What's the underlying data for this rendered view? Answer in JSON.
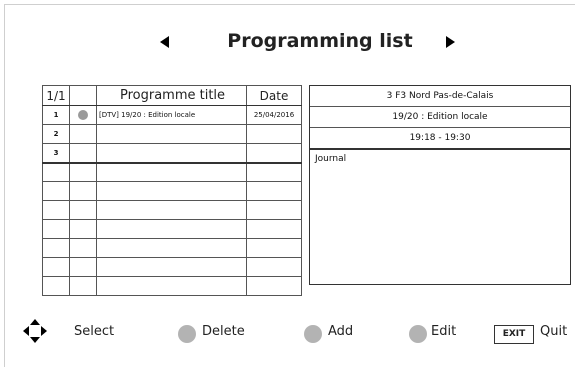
{
  "header": {
    "title": "Programming list"
  },
  "list": {
    "headers": {
      "num": "1/1",
      "title": "Programme title",
      "date": "Date"
    },
    "rows": [
      {
        "num": "1",
        "has_icon": true,
        "title": "[DTV] 19/20 : Edition locale",
        "date": "25/04/2016"
      },
      {
        "num": "2",
        "has_icon": false,
        "title": "",
        "date": ""
      },
      {
        "num": "3",
        "has_icon": false,
        "title": "",
        "date": ""
      },
      {
        "num": "",
        "has_icon": false,
        "title": "",
        "date": ""
      },
      {
        "num": "",
        "has_icon": false,
        "title": "",
        "date": ""
      },
      {
        "num": "",
        "has_icon": false,
        "title": "",
        "date": ""
      },
      {
        "num": "",
        "has_icon": false,
        "title": "",
        "date": ""
      },
      {
        "num": "",
        "has_icon": false,
        "title": "",
        "date": ""
      },
      {
        "num": "",
        "has_icon": false,
        "title": "",
        "date": ""
      },
      {
        "num": "",
        "has_icon": false,
        "title": "",
        "date": ""
      }
    ]
  },
  "detail": {
    "channel": "3 F3 Nord Pas-de-Calais",
    "programme": "19/20 : Edition locale",
    "time": "19:18 - 19:30",
    "genre": "Journal"
  },
  "legend": {
    "select": "Select",
    "delete": "Delete",
    "add": "Add",
    "edit": "Edit",
    "exit_key": "EXIT",
    "quit": "Quit"
  },
  "colors": {
    "key_dot": "#b3b3b3",
    "row_icon": "#9a9a9a"
  }
}
